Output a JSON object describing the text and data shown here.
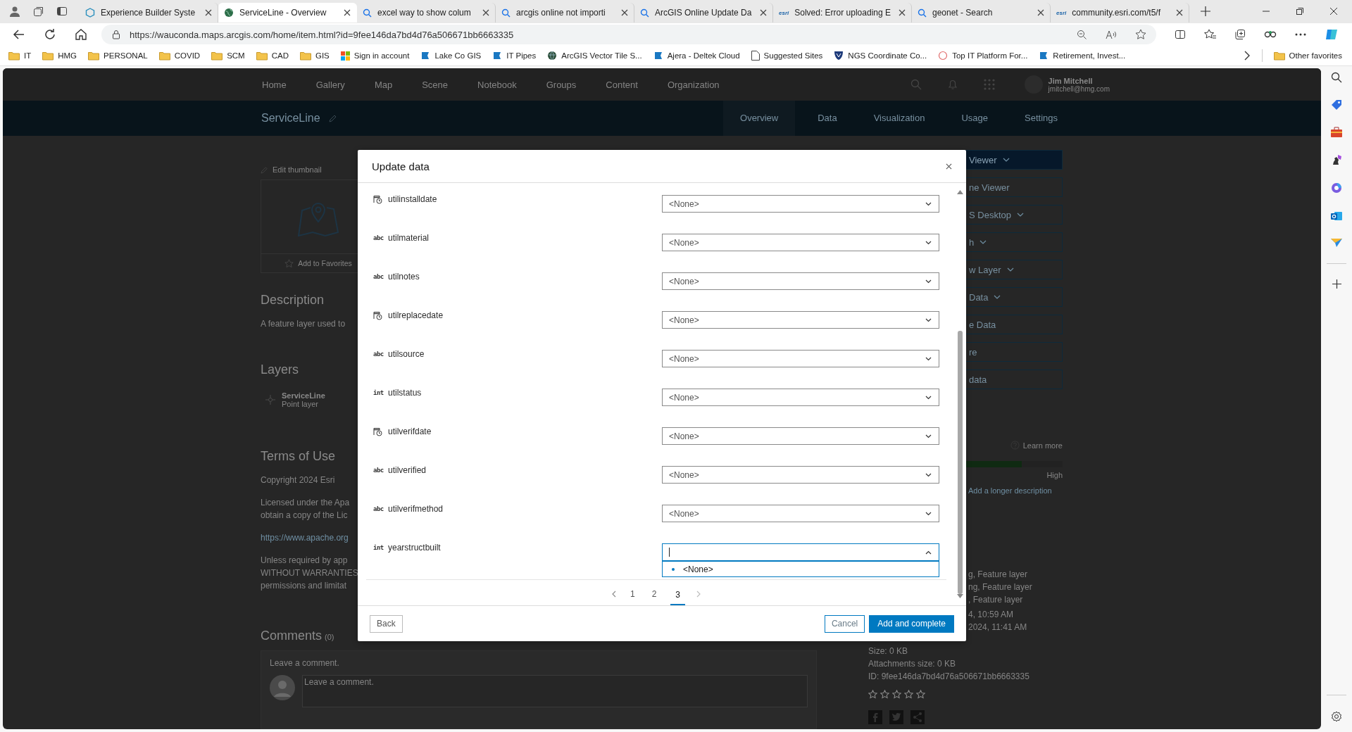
{
  "browser": {
    "tabs": [
      {
        "title": "Experience Builder Syste",
        "kind": "builder",
        "selected": false
      },
      {
        "title": "ServiceLine - Overview",
        "kind": "globe",
        "selected": true
      },
      {
        "title": "excel way to show colum",
        "kind": "search",
        "selected": false
      },
      {
        "title": "arcgis online not importi",
        "kind": "search",
        "selected": false
      },
      {
        "title": "ArcGIS Online Update Da",
        "kind": "search",
        "selected": false
      },
      {
        "title": "Solved: Error uploading E",
        "kind": "text",
        "icon_text": "esri",
        "selected": false
      },
      {
        "title": "geonet - Search",
        "kind": "search",
        "selected": false
      },
      {
        "title": "community.esri.com/t5/f",
        "kind": "text",
        "icon_text": "esri",
        "selected": false
      }
    ],
    "address": "https://wauconda.maps.arcgis.com/home/item.html?id=9fee146da7bd4d76a506671bb6663335",
    "favorites": [
      {
        "label": "IT",
        "kind": "folder"
      },
      {
        "label": "HMG",
        "kind": "folder"
      },
      {
        "label": "PERSONAL",
        "kind": "folder"
      },
      {
        "label": "COVID",
        "kind": "folder"
      },
      {
        "label": "SCM",
        "kind": "folder"
      },
      {
        "label": "CAD",
        "kind": "folder"
      },
      {
        "label": "GIS",
        "kind": "folder"
      },
      {
        "label": "Sign in account",
        "kind": "windows"
      },
      {
        "label": "Lake Co GIS",
        "kind": "site"
      },
      {
        "label": "IT Pipes",
        "kind": "site"
      },
      {
        "label": "ArcGIS Vector Tile S...",
        "kind": "globe"
      },
      {
        "label": "Ajera - Deltek Cloud",
        "kind": "site"
      },
      {
        "label": "Suggested Sites",
        "kind": "page"
      },
      {
        "label": "NGS Coordinate Co...",
        "kind": "shield"
      },
      {
        "label": "Top IT Platform For...",
        "kind": "ring"
      },
      {
        "label": "Retirement, Invest...",
        "kind": "site"
      }
    ],
    "other_favorites": "Other favorites"
  },
  "portal": {
    "nav": [
      "Home",
      "Gallery",
      "Map",
      "Scene",
      "Notebook",
      "Groups",
      "Content",
      "Organization"
    ],
    "user_name": "Jim Mitchell",
    "user_email": "jmitchell@hmg.com"
  },
  "item_bar": {
    "title": "ServiceLine",
    "tabs": [
      {
        "label": "Overview",
        "selected": true
      },
      {
        "label": "Data",
        "selected": false
      },
      {
        "label": "Visualization",
        "selected": false
      },
      {
        "label": "Usage",
        "selected": false
      },
      {
        "label": "Settings",
        "selected": false
      }
    ]
  },
  "left": {
    "edit_thumbnail": "Edit thumbnail",
    "add_favorites": "Add to Favorites",
    "description_heading": "Description",
    "description": "A feature layer used to",
    "layers_heading": "Layers",
    "layer_name": "ServiceLine",
    "layer_type": "Point layer",
    "terms_heading": "Terms of Use",
    "terms": [
      {
        "kind": "text",
        "lines": [
          "Copyright 2024 Esri"
        ]
      },
      {
        "kind": "text",
        "lines": [
          "Licensed under the Apa",
          "obtain a copy of the Lic"
        ]
      },
      {
        "kind": "link",
        "lines": [
          "https://www.apache.org"
        ]
      },
      {
        "kind": "text",
        "lines": [
          "Unless required by app",
          "WITHOUT WARRANTIES",
          "permissions and limitat"
        ]
      }
    ],
    "comments_heading": "Comments",
    "comments_count": "(0)",
    "comment_prompt": "Leave a comment.",
    "comment_placeholder": "Leave a comment."
  },
  "right": {
    "buttons": [
      {
        "label": "Viewer",
        "kind": "primary",
        "caret": true
      },
      {
        "label": "ne Viewer",
        "kind": "outline",
        "caret": false
      },
      {
        "label": "S Desktop",
        "kind": "outline",
        "caret": true
      },
      {
        "label": "h",
        "kind": "outline",
        "caret": true
      },
      {
        "label": "w Layer",
        "kind": "outline",
        "caret": true
      },
      {
        "label": "Data",
        "kind": "outline",
        "caret": true
      },
      {
        "label": "e Data",
        "kind": "outline",
        "caret": false
      },
      {
        "label": "re",
        "kind": "outline",
        "caret": false
      },
      {
        "label": "data",
        "kind": "outline",
        "caret": false
      }
    ],
    "learn_more": "Learn more",
    "score": {
      "level": 0.79,
      "label": "High"
    },
    "add_description": "Add a longer description",
    "details": [
      "g, Feature layer",
      "ng, Feature layer",
      ", Feature layer",
      "4, 10:59 AM",
      "2024, 11:41 AM"
    ],
    "size": "Size: 0 KB",
    "attachments": "Attachments size: 0 KB",
    "id": "ID: 9fee146da7bd4d76a506671bb6663335",
    "stars": 0
  },
  "dialog": {
    "title": "Update data",
    "fields": [
      {
        "name": "utilinstalldate",
        "kind": "date",
        "value": "<None>",
        "open": false
      },
      {
        "name": "utilmaterial",
        "kind": "text",
        "type_label": "abc",
        "value": "<None>",
        "open": false
      },
      {
        "name": "utilnotes",
        "kind": "text",
        "type_label": "abc",
        "value": "<None>",
        "open": false
      },
      {
        "name": "utilreplacedate",
        "kind": "date",
        "value": "<None>",
        "open": false
      },
      {
        "name": "utilsource",
        "kind": "text",
        "type_label": "abc",
        "value": "<None>",
        "open": false
      },
      {
        "name": "utilstatus",
        "kind": "text",
        "type_label": "int",
        "value": "<None>",
        "open": false
      },
      {
        "name": "utilverifdate",
        "kind": "date",
        "value": "<None>",
        "open": false
      },
      {
        "name": "utilverified",
        "kind": "text",
        "type_label": "abc",
        "value": "<None>",
        "open": false
      },
      {
        "name": "utilverifmethod",
        "kind": "text",
        "type_label": "abc",
        "value": "<None>",
        "open": false
      },
      {
        "name": "yearstructbuilt",
        "kind": "text",
        "type_label": "int",
        "open": true,
        "options": [
          {
            "label": "<None>",
            "selected": true
          }
        ]
      }
    ],
    "pages": [
      {
        "label": "1",
        "selected": false
      },
      {
        "label": "2",
        "selected": false
      },
      {
        "label": "3",
        "selected": true
      }
    ],
    "back": "Back",
    "cancel": "Cancel",
    "submit": "Add and complete"
  }
}
